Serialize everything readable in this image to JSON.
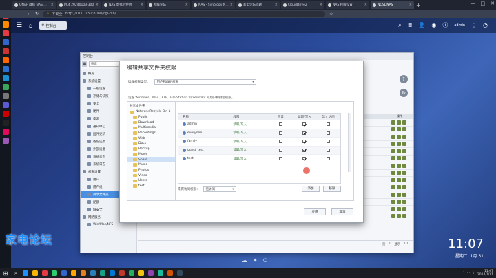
{
  "browser": {
    "tabs": [
      {
        "title": "QNAP 群晖 NAS 教程",
        "active": false
      },
      {
        "title": "PC4 20240103-300",
        "active": false
      },
      {
        "title": "NAS 虚拟机使用",
        "active": false
      },
      {
        "title": "群晖论坛",
        "active": false
      },
      {
        "title": "NAS - Synology NAS",
        "active": false
      },
      {
        "title": "家电论坛问题",
        "active": false
      },
      {
        "title": "CloudDrive2",
        "active": false
      },
      {
        "title": "NAS 权限设置",
        "active": false
      },
      {
        "title": "NOSDNAS",
        "active": true
      }
    ],
    "new_tab": "+",
    "controls": [
      "—",
      "□",
      "✕"
    ],
    "security_label": "不安全",
    "url": "http://10.0.0.52:8080/cgi-bin/"
  },
  "sidebar_colors": [
    "#e63946",
    "#ff8800",
    "#e63946",
    "#3366cc",
    "#cc3333",
    "#ff6600",
    "#2b6fd1",
    "#1a8fd1",
    "#3ba55c",
    "#777777",
    "#5b5bd6",
    "#cc0000",
    "#222222",
    "#e00b5b",
    "#9b59b6"
  ],
  "nas": {
    "app_tab": "控制台",
    "user": "admin",
    "right_icons": [
      "search-icon",
      "stack-icon",
      "user-icon",
      "badge-icon",
      "info-icon",
      "dashboard-icon"
    ]
  },
  "control_panel": {
    "title": "控制台",
    "search_placeholder": "搜索",
    "nav": [
      {
        "label": "概览",
        "group": true
      },
      {
        "label": "系统设置",
        "group": true
      },
      {
        "label": "一般设置",
        "group": false
      },
      {
        "label": "存储与快照",
        "group": false
      },
      {
        "label": "安全",
        "group": false
      },
      {
        "label": "硬件",
        "group": false
      },
      {
        "label": "电源",
        "group": false
      },
      {
        "label": "通知中心",
        "group": false
      },
      {
        "label": "固件更新",
        "group": false
      },
      {
        "label": "备份还原",
        "group": false
      },
      {
        "label": "外部设备",
        "group": false
      },
      {
        "label": "系统状态",
        "group": false
      },
      {
        "label": "系统日志",
        "group": false
      },
      {
        "label": "权限设置",
        "group": true
      },
      {
        "label": "用户",
        "group": false
      },
      {
        "label": "用户组",
        "group": false
      },
      {
        "label": "共享文件夹",
        "group": false,
        "selected": true
      },
      {
        "label": "配额",
        "group": false
      },
      {
        "label": "域安全",
        "group": false
      },
      {
        "label": "网络服务",
        "group": true
      },
      {
        "label": "Win/Mac/NFS",
        "group": false
      }
    ],
    "table_header": "操作",
    "footer": {
      "page_label": "页",
      "page": "1",
      "show_label": "显示",
      "count": "10"
    }
  },
  "dialog": {
    "title": "编辑共享文件夹权限",
    "type_label": "选择权限类型：",
    "type_value": "用户和群组权限",
    "note": "设置 Windows、Mac、FTP、File Station 和 WebDAV 的用户和群组权限。",
    "tree_root_label": "共享文件夹",
    "tree": [
      {
        "label": "Network Recycle Bin 1",
        "top": true
      },
      {
        "label": "Public",
        "top": false
      },
      {
        "label": "Download",
        "top": false
      },
      {
        "label": "Multimedia",
        "top": false
      },
      {
        "label": "Recordings",
        "top": false
      },
      {
        "label": "Web",
        "top": false
      },
      {
        "label": "Docs",
        "top": false
      },
      {
        "label": "Backup",
        "top": false
      },
      {
        "label": "Movie",
        "top": false
      },
      {
        "label": "Share",
        "top": false,
        "selected": true
      },
      {
        "label": "Music",
        "top": false
      },
      {
        "label": "Photos",
        "top": false
      },
      {
        "label": "Video",
        "top": false
      },
      {
        "label": "Users",
        "top": false
      },
      {
        "label": "test",
        "top": false
      }
    ],
    "columns": {
      "name": "名称",
      "perm": "权限",
      "ro": "只读",
      "rw": "读取/写入",
      "deny": "禁止访问"
    },
    "rows": [
      {
        "name": "admin",
        "perm": "读取/写入",
        "ro": false,
        "rw": true,
        "deny": false
      },
      {
        "name": "everyone",
        "perm": "读取/写入",
        "ro": false,
        "rw": true,
        "deny": false
      },
      {
        "name": "family",
        "perm": "读取/写入",
        "ro": false,
        "rw": true,
        "deny": false
      },
      {
        "name": "guest_test",
        "perm": "读取/写入",
        "ro": false,
        "rw": true,
        "deny": false
      },
      {
        "name": "test",
        "perm": "读取/写入",
        "ro": false,
        "rw": true,
        "deny": false
      }
    ],
    "guest_label": "来宾访问权限：",
    "guest_value": "无访问",
    "add_button": "添加",
    "remove_button": "移除",
    "apply_button": "应用",
    "cancel_button": "取消"
  },
  "desktop": {
    "time": "11:07",
    "date": "星期二, 1月 31",
    "watermark": "家电论坛"
  },
  "taskbar": {
    "app_colors": [
      "#1e90ff",
      "#f7b500",
      "#e63946",
      "#2ecc71",
      "#3366cc",
      "#ffa500",
      "#e67e22",
      "#2980b9",
      "#16a085",
      "#0078d4",
      "#c0392b",
      "#27ae60",
      "#f1c40f",
      "#8e44ad",
      "#1abc9c",
      "#d35400",
      "#34495e"
    ],
    "tray_time": "11:07",
    "tray_date": "2024/1/31"
  }
}
